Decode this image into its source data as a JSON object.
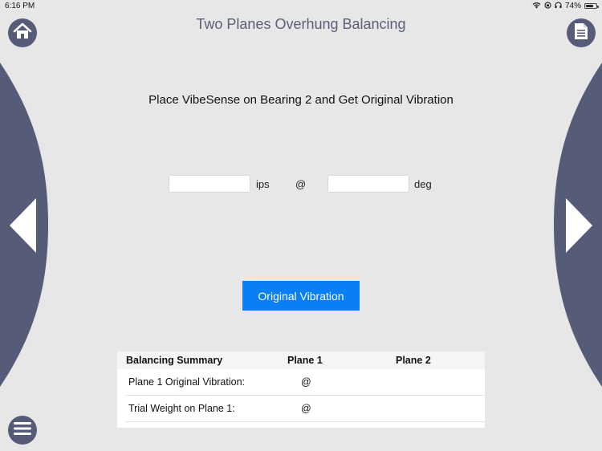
{
  "status_bar": {
    "time": "6:16 PM",
    "battery_percent": "74%",
    "battery_level": 0.74,
    "icons": [
      "wifi-icon",
      "orientation-lock-icon",
      "headphones-icon",
      "battery-icon"
    ]
  },
  "header": {
    "title": "Two Planes Overhung Balancing",
    "home_icon": "home-icon",
    "report_icon": "document-icon"
  },
  "navigation": {
    "prev_icon": "chevron-left-icon",
    "next_icon": "chevron-right-icon",
    "menu_icon": "hamburger-menu-icon"
  },
  "main": {
    "instruction": "Place VibeSense on Bearing 2 and Get Original Vibration",
    "amplitude": {
      "value": "",
      "placeholder": "",
      "unit": "ips"
    },
    "at_symbol": "@",
    "phase": {
      "value": "",
      "placeholder": "",
      "unit": "deg"
    },
    "action_button": "Original Vibration"
  },
  "summary": {
    "headers": [
      "Balancing Summary",
      "Plane 1",
      "Plane 2"
    ],
    "rows": [
      {
        "label": "Plane 1 Original Vibration:",
        "plane1": "@",
        "plane2": ""
      },
      {
        "label": "Trial Weight on Plane 1:",
        "plane1": "@",
        "plane2": ""
      }
    ]
  },
  "colors": {
    "background": "#e7e7e7",
    "nav_dark": "#565b78",
    "accent_blue": "#0a7ff5",
    "title_color": "#5a5f7a"
  }
}
